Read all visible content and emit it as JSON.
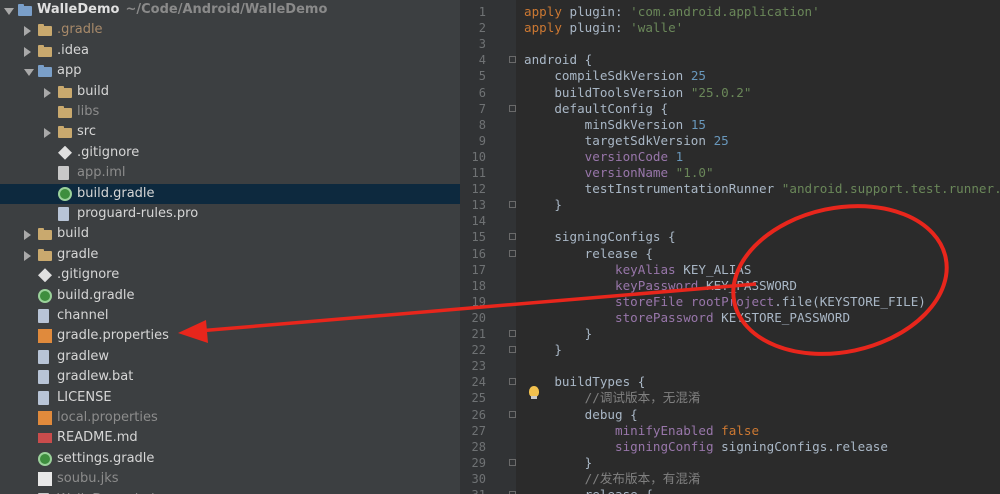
{
  "project": {
    "name": "WalleDemo",
    "path": "~/Code/Android/WalleDemo"
  },
  "tree": [
    {
      "label": "WalleDemo",
      "sub": "~/Code/Android/WalleDemo",
      "icon": "module-folder-icon",
      "arrow": "down",
      "indent": 0,
      "state": "normal"
    },
    {
      "label": ".gradle",
      "icon": "folder-icon",
      "arrow": "right",
      "indent": 1,
      "state": "dim2"
    },
    {
      "label": ".idea",
      "icon": "folder-icon",
      "arrow": "right",
      "indent": 1,
      "state": "normal"
    },
    {
      "label": "app",
      "icon": "module-folder-icon",
      "arrow": "down",
      "indent": 1,
      "state": "normal"
    },
    {
      "label": "build",
      "icon": "folder-icon",
      "arrow": "right",
      "indent": 2,
      "state": "normal"
    },
    {
      "label": "libs",
      "icon": "folder-icon",
      "arrow": "none",
      "indent": 2,
      "state": "dim"
    },
    {
      "label": "src",
      "icon": "folder-icon",
      "arrow": "right",
      "indent": 2,
      "state": "normal"
    },
    {
      "label": ".gitignore",
      "icon": "git-file-icon",
      "arrow": "none",
      "indent": 2,
      "state": "normal"
    },
    {
      "label": "app.iml",
      "icon": "iml-file-icon",
      "arrow": "none",
      "indent": 2,
      "state": "dim"
    },
    {
      "label": "build.gradle",
      "icon": "gradle-file-icon",
      "arrow": "none",
      "indent": 2,
      "state": "selected"
    },
    {
      "label": "proguard-rules.pro",
      "icon": "text-file-icon",
      "arrow": "none",
      "indent": 2,
      "state": "normal"
    },
    {
      "label": "build",
      "icon": "folder-icon",
      "arrow": "right",
      "indent": 1,
      "state": "normal"
    },
    {
      "label": "gradle",
      "icon": "folder-icon",
      "arrow": "right",
      "indent": 1,
      "state": "normal"
    },
    {
      "label": ".gitignore",
      "icon": "git-file-icon",
      "arrow": "none",
      "indent": 1,
      "state": "normal"
    },
    {
      "label": "build.gradle",
      "icon": "gradle-file-icon",
      "arrow": "none",
      "indent": 1,
      "state": "normal"
    },
    {
      "label": "channel",
      "icon": "text-file-icon",
      "arrow": "none",
      "indent": 1,
      "state": "normal"
    },
    {
      "label": "gradle.properties",
      "icon": "properties-file-icon",
      "arrow": "none",
      "indent": 1,
      "state": "normal"
    },
    {
      "label": "gradlew",
      "icon": "text-file-icon",
      "arrow": "none",
      "indent": 1,
      "state": "normal"
    },
    {
      "label": "gradlew.bat",
      "icon": "text-file-icon",
      "arrow": "none",
      "indent": 1,
      "state": "normal"
    },
    {
      "label": "LICENSE",
      "icon": "text-file-icon",
      "arrow": "none",
      "indent": 1,
      "state": "normal"
    },
    {
      "label": "local.properties",
      "icon": "properties-file-icon",
      "arrow": "none",
      "indent": 1,
      "state": "dim"
    },
    {
      "label": "README.md",
      "icon": "markdown-file-icon",
      "arrow": "none",
      "indent": 1,
      "state": "normal"
    },
    {
      "label": "settings.gradle",
      "icon": "gradle-file-icon",
      "arrow": "none",
      "indent": 1,
      "state": "normal"
    },
    {
      "label": "soubu.jks",
      "icon": "keystore-file-icon",
      "arrow": "none",
      "indent": 1,
      "state": "dim"
    },
    {
      "label": "WalleDemo.iml",
      "icon": "iml-file-icon",
      "arrow": "none",
      "indent": 1,
      "state": "dim"
    }
  ],
  "code": [
    {
      "n": "1",
      "t": [
        [
          "apply ",
          "kw"
        ],
        [
          "plugin",
          "plain"
        ],
        [
          ": ",
          "plain"
        ],
        [
          "'com.android.application'",
          "str"
        ]
      ]
    },
    {
      "n": "2",
      "t": [
        [
          "apply ",
          "kw"
        ],
        [
          "plugin",
          "plain"
        ],
        [
          ": ",
          "plain"
        ],
        [
          "'walle'",
          "str"
        ]
      ]
    },
    {
      "n": "3",
      "t": []
    },
    {
      "n": "4",
      "t": [
        [
          "android {",
          "plain"
        ]
      ]
    },
    {
      "n": "5",
      "t": [
        [
          "    compileSdkVersion ",
          "plain"
        ],
        [
          "25",
          "num"
        ]
      ]
    },
    {
      "n": "6",
      "t": [
        [
          "    buildToolsVersion ",
          "plain"
        ],
        [
          "\"25.0.2\"",
          "str"
        ]
      ]
    },
    {
      "n": "7",
      "t": [
        [
          "    defaultConfig {",
          "plain"
        ]
      ]
    },
    {
      "n": "8",
      "t": [
        [
          "        minSdkVersion ",
          "plain"
        ],
        [
          "15",
          "num"
        ]
      ]
    },
    {
      "n": "9",
      "t": [
        [
          "        targetSdkVersion ",
          "plain"
        ],
        [
          "25",
          "num"
        ]
      ]
    },
    {
      "n": "10",
      "t": [
        [
          "        versionCode ",
          "prop"
        ],
        [
          "1",
          "num"
        ]
      ]
    },
    {
      "n": "11",
      "t": [
        [
          "        versionName ",
          "prop"
        ],
        [
          "\"1.0\"",
          "str"
        ]
      ]
    },
    {
      "n": "12",
      "t": [
        [
          "        testInstrumentationRunner ",
          "plain"
        ],
        [
          "\"android.support.test.runner.A",
          "str"
        ]
      ]
    },
    {
      "n": "13",
      "t": [
        [
          "    }",
          "plain"
        ]
      ]
    },
    {
      "n": "14",
      "t": []
    },
    {
      "n": "15",
      "t": [
        [
          "    signingConfigs {",
          "plain"
        ]
      ]
    },
    {
      "n": "16",
      "t": [
        [
          "        release {",
          "plain"
        ]
      ]
    },
    {
      "n": "17",
      "t": [
        [
          "            keyAlias ",
          "prop"
        ],
        [
          "KEY_ALIAS",
          "plain"
        ]
      ]
    },
    {
      "n": "18",
      "t": [
        [
          "            keyPassword ",
          "prop"
        ],
        [
          "KEY_PASSWORD",
          "plain"
        ]
      ]
    },
    {
      "n": "19",
      "t": [
        [
          "            storeFile ",
          "prop"
        ],
        [
          "rootProject",
          "prop"
        ],
        [
          ".file(KEYSTORE_FILE)",
          "plain"
        ]
      ]
    },
    {
      "n": "20",
      "t": [
        [
          "            storePassword ",
          "prop"
        ],
        [
          "KEYSTORE_PASSWORD",
          "plain"
        ]
      ]
    },
    {
      "n": "21",
      "t": [
        [
          "        }",
          "plain"
        ]
      ]
    },
    {
      "n": "22",
      "t": [
        [
          "    }",
          "plain"
        ]
      ]
    },
    {
      "n": "23",
      "t": []
    },
    {
      "n": "24",
      "t": [
        [
          "    buildTypes {",
          "plain"
        ]
      ]
    },
    {
      "n": "25",
      "t": [
        [
          "        //调试版本，无混淆",
          "cmt"
        ]
      ]
    },
    {
      "n": "26",
      "t": [
        [
          "        debug {",
          "plain"
        ]
      ]
    },
    {
      "n": "27",
      "t": [
        [
          "            minifyEnabled ",
          "prop"
        ],
        [
          "false",
          "kw"
        ]
      ]
    },
    {
      "n": "28",
      "t": [
        [
          "            signingConfig ",
          "prop"
        ],
        [
          "signingConfigs.release",
          "plain"
        ]
      ]
    },
    {
      "n": "29",
      "t": [
        [
          "        }",
          "plain"
        ]
      ]
    },
    {
      "n": "30",
      "t": [
        [
          "        //发布版本，有混淆",
          "cmt"
        ]
      ]
    },
    {
      "n": "31",
      "t": [
        [
          "        release {",
          "plain"
        ]
      ]
    }
  ],
  "colors": {
    "annotation": "#e8261c",
    "selection": "#0d293e"
  }
}
